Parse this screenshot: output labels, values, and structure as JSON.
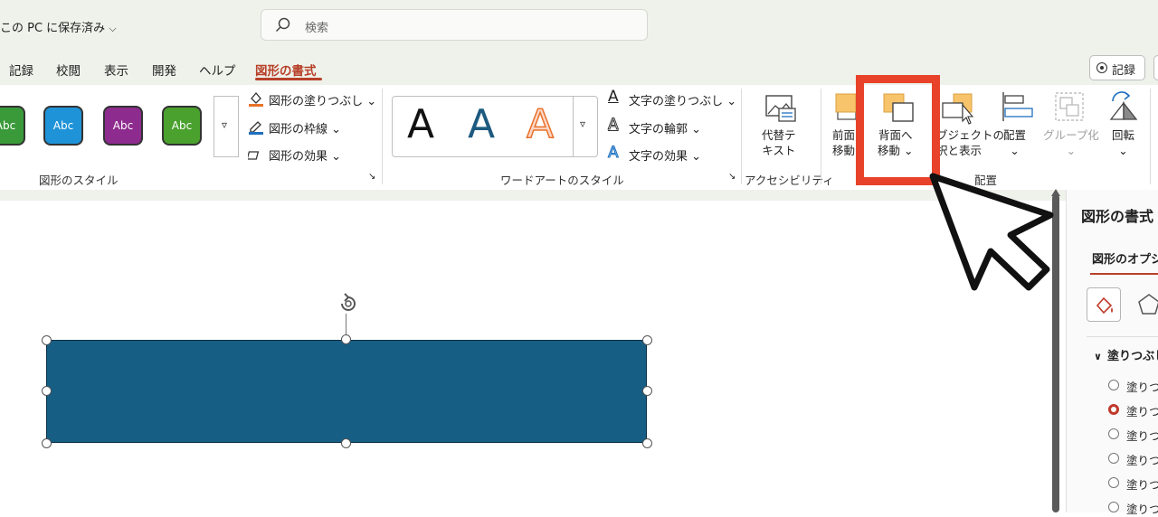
{
  "title_bar": {
    "doc_status": "この PC に保存済み",
    "search_placeholder": "検索"
  },
  "tabs": [
    "記録",
    "校閲",
    "表示",
    "開発",
    "ヘルプ"
  ],
  "active_tab": "図形の書式",
  "record_button": "記録",
  "shape_styles": {
    "swatches": [
      {
        "label": "Abc",
        "color": "#3a9a3a"
      },
      {
        "label": "Abc",
        "color": "#1f93d8"
      },
      {
        "label": "Abc",
        "color": "#8e2b8e"
      },
      {
        "label": "Abc",
        "color": "#4aa12e"
      }
    ],
    "commands": [
      "図形の塗りつぶし",
      "図形の枠線",
      "図形の効果"
    ],
    "group_label": "図形のスタイル"
  },
  "wordart": {
    "letters": [
      "A",
      "A",
      "A"
    ],
    "commands": [
      "文字の塗りつぶし",
      "文字の輪郭",
      "文字の効果"
    ],
    "group_label": "ワードアートのスタイル"
  },
  "accessibility": {
    "alt_text_line1": "代替テ",
    "alt_text_line2": "キスト",
    "group_label": "アクセシビリティ"
  },
  "arrange": {
    "bring_forward_line1": "前面",
    "bring_forward_line2": "移動",
    "send_backward_line1": "背面へ",
    "send_backward_line2": "移動",
    "selection_pane_line1": "ブジェクトの",
    "selection_pane_line2": "択と表示",
    "align": "配置",
    "group": "グループ化",
    "rotate": "回転",
    "group_label": "配置"
  },
  "pane": {
    "title": "図形の書式",
    "tab": "図形のオプシ",
    "section": "塗りつぶし",
    "options": [
      "塗りつ",
      "塗りつ",
      "塗りつ",
      "塗りつ",
      "塗りつ",
      "塗りつ"
    ],
    "selected_index": 1
  },
  "colors": {
    "accent": "#b8402a",
    "shape_fill": "#175e84",
    "highlight": "#e8432a"
  }
}
